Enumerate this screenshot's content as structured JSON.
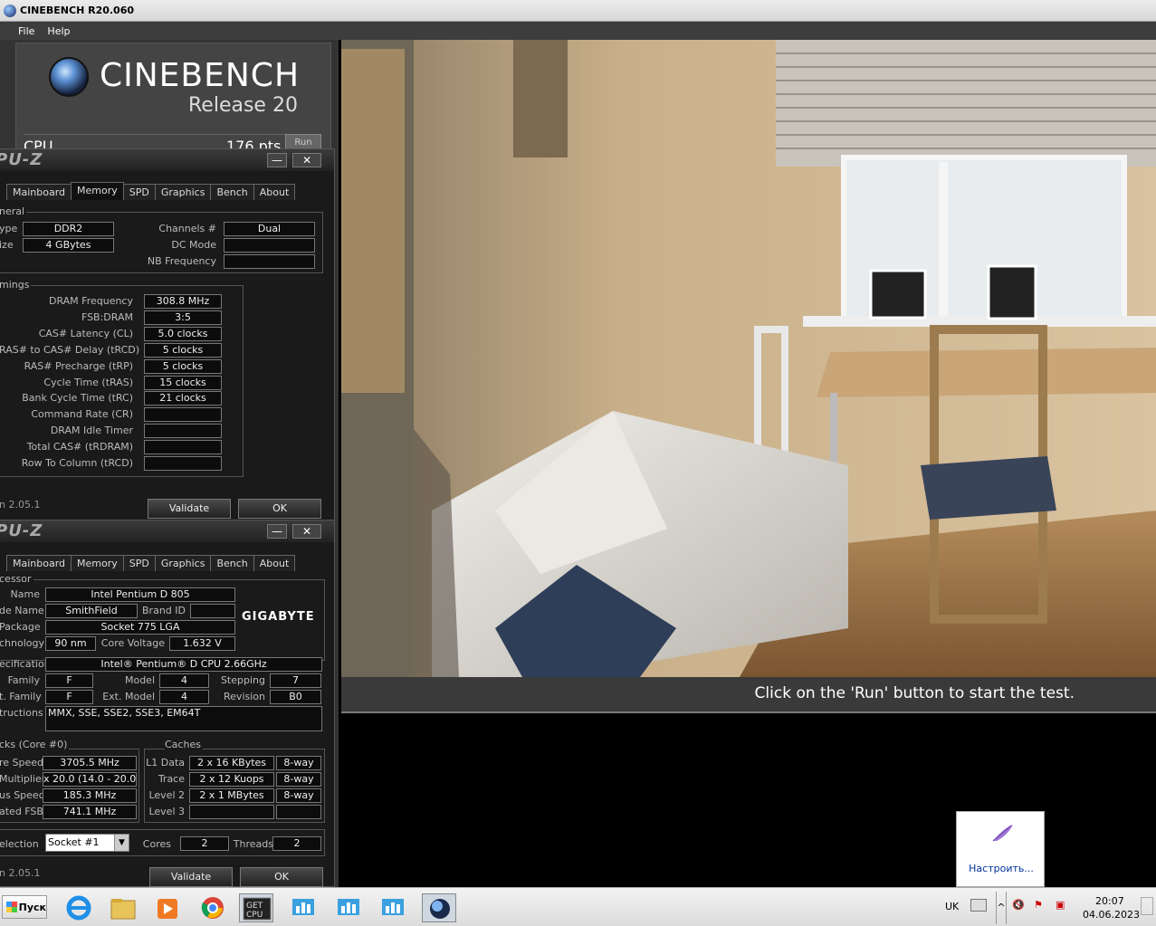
{
  "cinebench": {
    "window_title": "CINEBENCH R20.060",
    "menu": [
      "File",
      "Help"
    ],
    "logo_title": "CINEBENCH",
    "logo_subtitle": "Release 20",
    "cpu_label": "CPU",
    "cpu_score": "176 pts",
    "run_button": "Run",
    "status_text": "Click on the 'Run' button to start the test."
  },
  "cpuz_memory": {
    "title": "PU-Z",
    "tabs": [
      "Mainboard",
      "Memory",
      "SPD",
      "Graphics",
      "Bench",
      "About"
    ],
    "active_tab": "Memory",
    "general_label": "neral",
    "type_label": "ype",
    "type_value": "DDR2",
    "size_label": "ize",
    "size_value": "4 GBytes",
    "channels_label": "Channels #",
    "channels_value": "Dual",
    "dc_mode_label": "DC Mode",
    "dc_mode_value": "",
    "nb_freq_label": "NB Frequency",
    "nb_freq_value": "",
    "timings_label": "mings",
    "timings": [
      {
        "label": "DRAM Frequency",
        "value": "308.8 MHz"
      },
      {
        "label": "FSB:DRAM",
        "value": "3:5"
      },
      {
        "label": "CAS# Latency (CL)",
        "value": "5.0 clocks"
      },
      {
        "label": "RAS# to CAS# Delay (tRCD)",
        "value": "5 clocks"
      },
      {
        "label": "RAS# Precharge (tRP)",
        "value": "5 clocks"
      },
      {
        "label": "Cycle Time (tRAS)",
        "value": "15 clocks"
      },
      {
        "label": "Bank Cycle Time (tRC)",
        "value": "21 clocks"
      },
      {
        "label": "Command Rate (CR)",
        "value": ""
      },
      {
        "label": "DRAM Idle Timer",
        "value": ""
      },
      {
        "label": "Total CAS# (tRDRAM)",
        "value": ""
      },
      {
        "label": "Row To Column (tRCD)",
        "value": ""
      }
    ],
    "version": "n 2.05.1",
    "validate_button": "Validate",
    "ok_button": "OK"
  },
  "cpuz_cpu": {
    "title": "PU-Z",
    "tabs": [
      "Mainboard",
      "Memory",
      "SPD",
      "Graphics",
      "Bench",
      "About"
    ],
    "processor_label": "cessor",
    "name_label": "Name",
    "name_value": "Intel Pentium D 805",
    "codename_label": "de Name",
    "codename_value": "SmithField",
    "brand_id_label": "Brand ID",
    "brand_id_value": "",
    "package_label": "Package",
    "package_value": "Socket 775 LGA",
    "technology_label": "chnology",
    "technology_value": "90 nm",
    "core_voltage_label": "Core Voltage",
    "core_voltage_value": "1.632 V",
    "brand_logo": "GIGABYTE",
    "specification_label": "ecification",
    "specification_value": "Intel® Pentium® D  CPU 2.66GHz",
    "family_label": "Family",
    "family_value": "F",
    "model_label": "Model",
    "model_value": "4",
    "stepping_label": "Stepping",
    "stepping_value": "7",
    "ext_family_label": "t. Family",
    "ext_family_value": "F",
    "ext_model_label": "Ext. Model",
    "ext_model_value": "4",
    "revision_label": "Revision",
    "revision_value": "B0",
    "instructions_label": "tructions",
    "instructions_value": "MMX, SSE, SSE2, SSE3, EM64T",
    "clocks_label": "cks (Core #0)",
    "core_speed_label": "re Speed",
    "core_speed_value": "3705.5 MHz",
    "multiplier_label": "Multiplier",
    "multiplier_value": "x 20.0 (14.0 - 20.0)",
    "bus_speed_label": "us Speed",
    "bus_speed_value": "185.3 MHz",
    "rated_fsb_label": "ated FSB",
    "rated_fsb_value": "741.1 MHz",
    "caches_label": "Caches",
    "l1_label": "L1 Data",
    "l1_value": "2 x 16 KBytes",
    "l1_way": "8-way",
    "trace_label": "Trace",
    "trace_value": "2 x 12 Kuops",
    "trace_way": "8-way",
    "l2_label": "Level 2",
    "l2_value": "2 x 1 MBytes",
    "l2_way": "8-way",
    "l3_label": "Level 3",
    "l3_value": "",
    "l3_way": "",
    "selection_label": "election",
    "selection_value": "Socket #1",
    "cores_label": "Cores",
    "cores_value": "2",
    "threads_label": "Threads",
    "threads_value": "2",
    "version": "n 2.05.1",
    "validate_button": "Validate",
    "ok_button": "OK"
  },
  "taskbar": {
    "start_label": "Пуск",
    "lang": "UK",
    "time": "20:07",
    "date": "04.06.2023",
    "popup_text": "Настроить..."
  }
}
